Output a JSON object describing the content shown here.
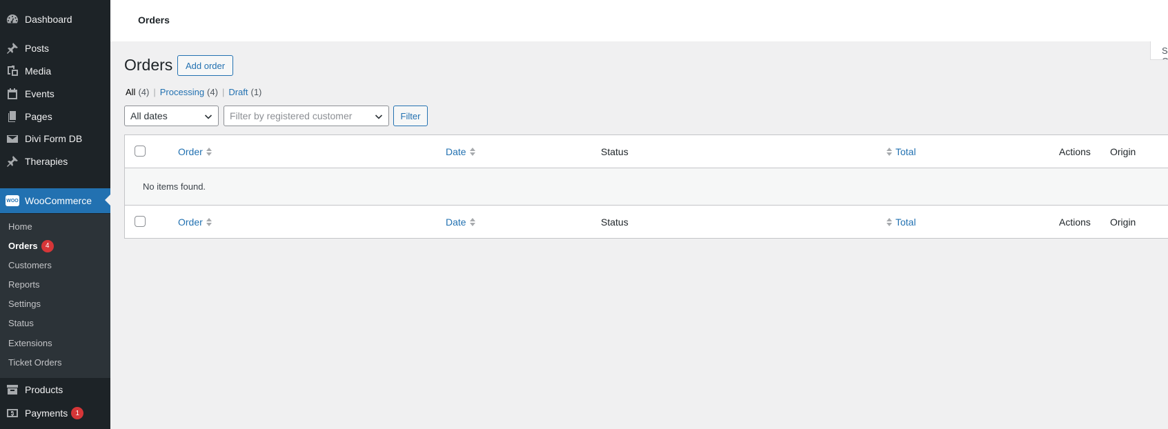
{
  "sidebar": {
    "items": [
      {
        "label": "Dashboard",
        "icon": "dashboard-icon"
      },
      {
        "label": "Posts",
        "icon": "pin-icon"
      },
      {
        "label": "Media",
        "icon": "media-icon"
      },
      {
        "label": "Events",
        "icon": "calendar-icon"
      },
      {
        "label": "Pages",
        "icon": "pages-icon"
      },
      {
        "label": "Divi Form DB",
        "icon": "email-icon"
      },
      {
        "label": "Therapies",
        "icon": "pin-icon"
      },
      {
        "label": "WooCommerce",
        "icon": "woo-icon"
      },
      {
        "label": "Products",
        "icon": "archive-icon"
      },
      {
        "label": "Payments",
        "icon": "money-icon",
        "badge": "1"
      }
    ],
    "woo_badge_text": "WOO",
    "submenu": [
      {
        "label": "Home"
      },
      {
        "label": "Orders",
        "badge": "4"
      },
      {
        "label": "Customers"
      },
      {
        "label": "Reports"
      },
      {
        "label": "Settings"
      },
      {
        "label": "Status"
      },
      {
        "label": "Extensions"
      },
      {
        "label": "Ticket Orders"
      }
    ]
  },
  "header": {
    "breadcrumb": "Orders",
    "screen_options": "Screen Options"
  },
  "main": {
    "title": "Orders",
    "add_button": "Add order",
    "views": [
      {
        "label": "All",
        "count": "(4)"
      },
      {
        "label": "Processing",
        "count": "(4)"
      },
      {
        "label": "Draft",
        "count": "(1)"
      }
    ],
    "separator": "|",
    "filters": {
      "dates": "All dates",
      "customer_placeholder": "Filter by registered customer",
      "filter_button": "Filter"
    },
    "table": {
      "columns": [
        "Order",
        "Date",
        "Status",
        "Total",
        "Actions",
        "Origin"
      ],
      "empty_message": "No items found."
    }
  },
  "colors": {
    "sidebar_bg": "#1d2327",
    "active_bg": "#2271b1",
    "submenu_bg": "#2c3338",
    "link": "#2271b1",
    "badge": "#d63638"
  }
}
